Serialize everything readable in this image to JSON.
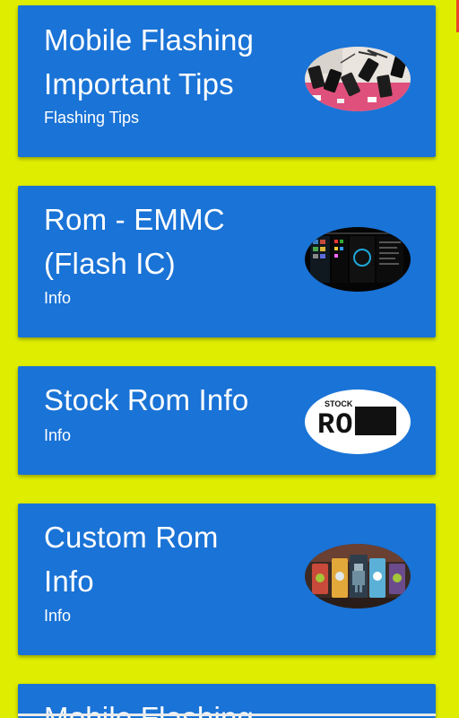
{
  "cards": [
    {
      "title_line1": "Mobile Flashing",
      "title_line2": "Important Tips",
      "subtitle": "Flashing Tips",
      "thumb_icon": "phones-on-board-photo"
    },
    {
      "title_line1": "Rom - EMMC",
      "title_line2": "(Flash IC)",
      "subtitle": "Info",
      "thumb_icon": "phone-screenshot-photo"
    },
    {
      "title_line1": "Stock Rom Info",
      "subtitle": "Info",
      "thumb_icon": "stock-rom-logo",
      "thumb_small_text": "STOCK",
      "thumb_big_text": "ROM"
    },
    {
      "title_line1": "Custom Rom",
      "title_line2": "Info",
      "subtitle": "Info",
      "thumb_icon": "android-robots-photo"
    },
    {
      "title_line1": "Mobile Flashing"
    }
  ],
  "colors": {
    "background": "#dfee00",
    "card": "#1a73d6",
    "text": "#ffffff"
  }
}
